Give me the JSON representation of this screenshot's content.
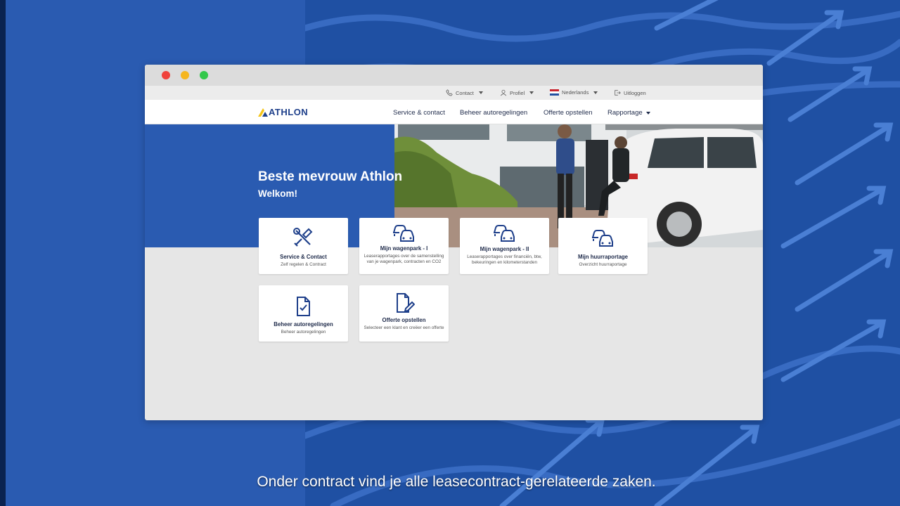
{
  "utility_nav": {
    "contact": "Contact",
    "profile": "Profiel",
    "language": "Nederlands",
    "logout": "Uitloggen"
  },
  "brand": {
    "logo_text": "ATHLON",
    "primary_color": "#2a5bb1",
    "accent_color": "#f5c518"
  },
  "main_nav": {
    "items": [
      "Service & contact",
      "Beheer autoregelingen",
      "Offerte opstellen",
      "Rapportage"
    ]
  },
  "hero": {
    "title": "Beste mevrouw Athlon",
    "subtitle": "Welkom!"
  },
  "tiles": [
    {
      "title": "Service & Contact",
      "desc": "Zelf regelen & Contract",
      "icon": "tools-icon"
    },
    {
      "title": "Mijn wagenpark - I",
      "desc": "Leaserapportages over de samenstelling van je wagenpark, contracten en CO2",
      "icon": "cars-icon"
    },
    {
      "title": "Mijn wagenpark - II",
      "desc": "Leaserapportages over financiën, btw, bekeuringen en kilometerstanden",
      "icon": "cars-icon"
    },
    {
      "title": "Mijn huurraportage",
      "desc": "Overzicht huurraportage",
      "icon": "cars-icon"
    },
    {
      "title": "Beheer autoregelingen",
      "desc": "Beheer autoregelingen",
      "icon": "document-check-icon"
    },
    {
      "title": "Offerte opstellen",
      "desc": "Selecteer een klant en creëer een offerte",
      "icon": "document-edit-icon"
    }
  ],
  "caption": "Onder contract vind je alle leasecontract-gerelateerde zaken."
}
